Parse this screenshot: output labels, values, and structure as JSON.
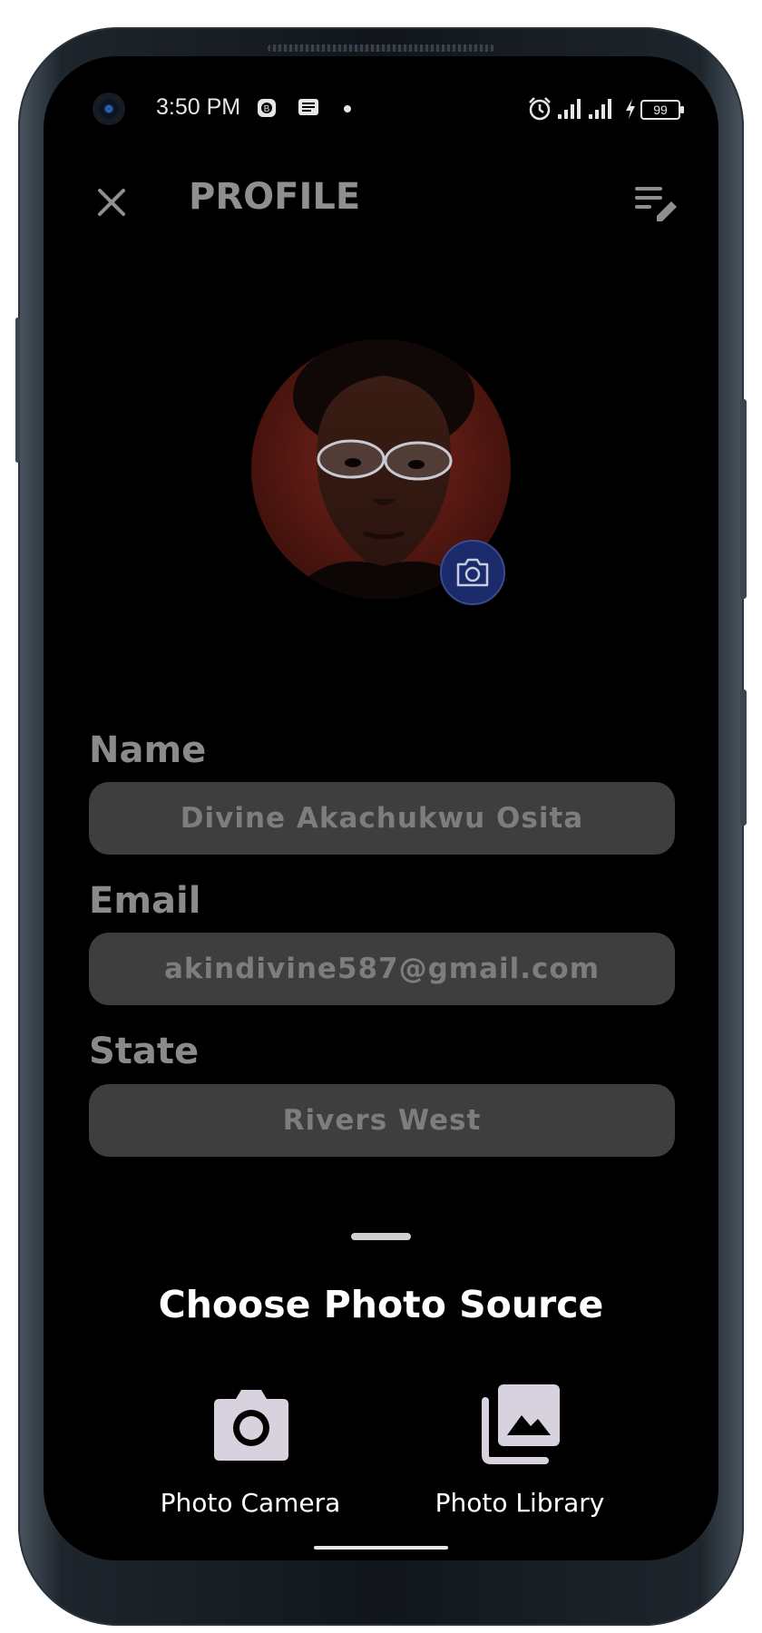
{
  "status_bar": {
    "time": "3:50 PM",
    "battery": "99",
    "icons": [
      "camera-hole",
      "app-notification-icon",
      "message-notification-icon",
      "dot-icon",
      "alarm-icon",
      "signal-icon",
      "signal-icon",
      "charging-icon",
      "battery-icon"
    ]
  },
  "header": {
    "title": "PROFILE",
    "close_icon": "close-icon",
    "edit_icon": "edit-list-icon"
  },
  "avatar": {
    "camera_button_icon": "camera-icon",
    "accent_color": "#1a2a6a"
  },
  "form": {
    "fields": [
      {
        "label": "Name",
        "value": "Divine Akachukwu Osita"
      },
      {
        "label": "Email",
        "value": "akindivine587@gmail.com"
      },
      {
        "label": "State",
        "value": "Rivers West"
      }
    ]
  },
  "sheet": {
    "title": "Choose Photo Source",
    "options": [
      {
        "label": "Photo Camera",
        "icon": "camera-icon"
      },
      {
        "label": "Photo Library",
        "icon": "photo-library-icon"
      }
    ]
  },
  "colors": {
    "background": "#000000",
    "field_bg": "#3e3e3e",
    "field_text": "#7d7d7d",
    "label_text": "#8a8a8a",
    "sheet_text": "#ffffff",
    "icon_fill": "#d8d2df"
  }
}
